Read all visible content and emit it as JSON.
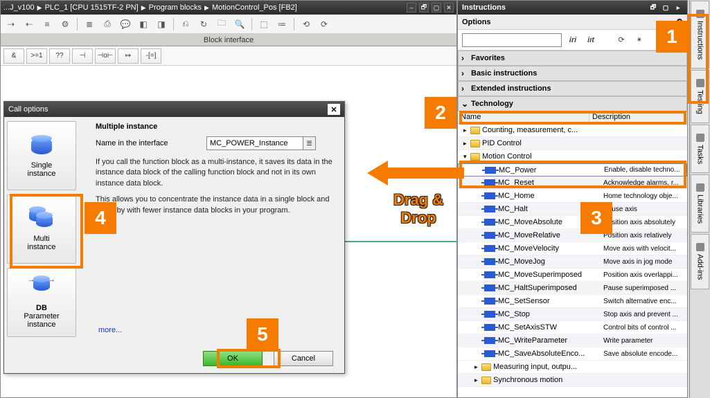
{
  "breadcrumbs": [
    "...J_v100",
    "PLC_1 [CPU 1515TF-2 PN]",
    "Program blocks",
    "MotionControl_Pos [FB2]"
  ],
  "block_interface": "Block interface",
  "operators": [
    "&",
    ">=1",
    "??",
    "⊣",
    "⊣o⊢",
    "↦",
    "-[=]"
  ],
  "dialog": {
    "title": "Call options",
    "options": [
      {
        "label": "Single\ninstance"
      },
      {
        "label": "Multi\ninstance"
      },
      {
        "label": "Parameter\ninstance",
        "db_text": "DB"
      }
    ],
    "heading": "Multiple instance",
    "field_label": "Name in the interface",
    "field_value": "MC_POWER_Instance",
    "para1": "If you call the function block as a multi-instance, it saves its data in the instance data block of the calling function block and not in its own instance data block.",
    "para2": "This allows you to concentrate the instance data in a single block and to get by with fewer instance data blocks in your program.",
    "more": "more...",
    "ok": "OK",
    "cancel": "Cancel"
  },
  "inst_panel": {
    "title": "Instructions",
    "options": "Options",
    "search_placeholder": "",
    "cats": [
      {
        "label": "Favorites",
        "expanded": false
      },
      {
        "label": "Basic instructions",
        "expanded": false
      },
      {
        "label": "Extended instructions",
        "expanded": false
      },
      {
        "label": "Technology",
        "expanded": true
      }
    ],
    "tree_headers": {
      "name": "Name",
      "desc": "Description"
    },
    "folders_top": [
      {
        "label": "Counting, measurement, c..."
      },
      {
        "label": "PID Control"
      }
    ],
    "motion_folder": "Motion Control",
    "mc_items": [
      {
        "n": "MC_Power",
        "d": "Enable, disable techno...",
        "hl": true
      },
      {
        "n": "MC_Reset",
        "d": "Acknowledge alarms, r..."
      },
      {
        "n": "MC_Home",
        "d": "Home technology obje..."
      },
      {
        "n": "MC_Halt",
        "d": "Pause axis"
      },
      {
        "n": "MC_MoveAbsolute",
        "d": "Position axis absolutely"
      },
      {
        "n": "MC_MoveRelative",
        "d": "Position axis relatively"
      },
      {
        "n": "MC_MoveVelocity",
        "d": "Move axis with velocit..."
      },
      {
        "n": "MC_MoveJog",
        "d": "Move axis in jog mode"
      },
      {
        "n": "MC_MoveSuperimposed",
        "d": "Position axis overlappi..."
      },
      {
        "n": "MC_HaltSuperimposed",
        "d": "Pause superimposed ..."
      },
      {
        "n": "MC_SetSensor",
        "d": "Switch alternative enc..."
      },
      {
        "n": "MC_Stop",
        "d": "Stop axis and prevent ..."
      },
      {
        "n": "MC_SetAxisSTW",
        "d": "Control bits of control ..."
      },
      {
        "n": "MC_WriteParameter",
        "d": "Write parameter"
      },
      {
        "n": "MC_SaveAbsoluteEnco...",
        "d": "Save absolute encode..."
      }
    ],
    "folders_bottom": [
      {
        "label": "Measuring input, outpu..."
      },
      {
        "label": "Synchronous motion"
      }
    ]
  },
  "side_tabs": [
    "Instructions",
    "Testing",
    "Tasks",
    "Libraries",
    "Add-ins"
  ],
  "annotations": {
    "drag": "Drag &\nDrop",
    "n1": "1",
    "n2": "2",
    "n3": "3",
    "n4": "4",
    "n5": "5"
  }
}
